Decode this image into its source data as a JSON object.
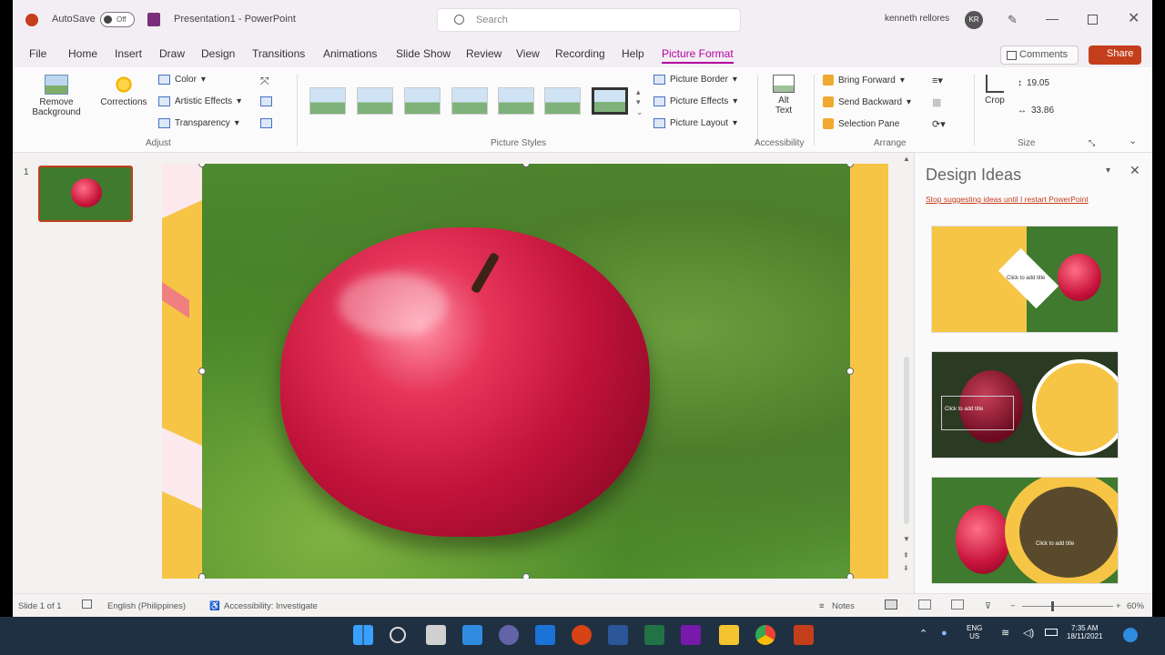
{
  "title_bar": {
    "autosave_label": "AutoSave",
    "autosave_state": "Off",
    "document_title": "Presentation1 - PowerPoint",
    "search_placeholder": "Search",
    "user_name": "kenneth rellores",
    "avatar_initials": "KR"
  },
  "tabs": [
    "File",
    "Home",
    "Insert",
    "Draw",
    "Design",
    "Transitions",
    "Animations",
    "Slide Show",
    "Review",
    "View",
    "Recording",
    "Help",
    "Picture Format"
  ],
  "active_tab": "Picture Format",
  "comments_label": "Comments",
  "share_label": "Share",
  "ribbon": {
    "adjust": {
      "remove_background_line1": "Remove",
      "remove_background_line2": "Background",
      "corrections": "Corrections",
      "color": "Color",
      "artistic_effects": "Artistic Effects",
      "transparency": "Transparency",
      "group_label": "Adjust"
    },
    "picture_styles": {
      "group_label": "Picture Styles",
      "picture_border": "Picture Border",
      "picture_effects": "Picture Effects",
      "picture_layout": "Picture Layout"
    },
    "accessibility": {
      "alt_text_line1": "Alt",
      "alt_text_line2": "Text",
      "group_label": "Accessibility"
    },
    "arrange": {
      "bring_forward": "Bring Forward",
      "send_backward": "Send Backward",
      "selection_pane": "Selection Pane",
      "group_label": "Arrange"
    },
    "size": {
      "crop": "Crop",
      "height": "19.05",
      "width": "33.86",
      "group_label": "Size"
    }
  },
  "slides_pane": {
    "slide_number": "1"
  },
  "design_ideas": {
    "title": "Design Ideas",
    "stop_link": "Stop suggesting ideas until I restart PowerPoint",
    "idea1_text": "Click to add title",
    "idea2_text": "Click to add title",
    "idea3_text": "Click to add title"
  },
  "status_bar": {
    "slide_info": "Slide 1 of 1",
    "language": "English (Philippines)",
    "accessibility": "Accessibility: Investigate",
    "notes": "Notes",
    "zoom": "60%"
  },
  "taskbar": {
    "lang_line1": "ENG",
    "lang_line2": "US",
    "time": "7:35 AM",
    "date": "18/11/2021"
  },
  "colors": {
    "accent": "#b4009e",
    "powerpoint_red": "#c43e1c",
    "slide_yellow": "#f7c545",
    "taskbar": "#1f3042"
  }
}
